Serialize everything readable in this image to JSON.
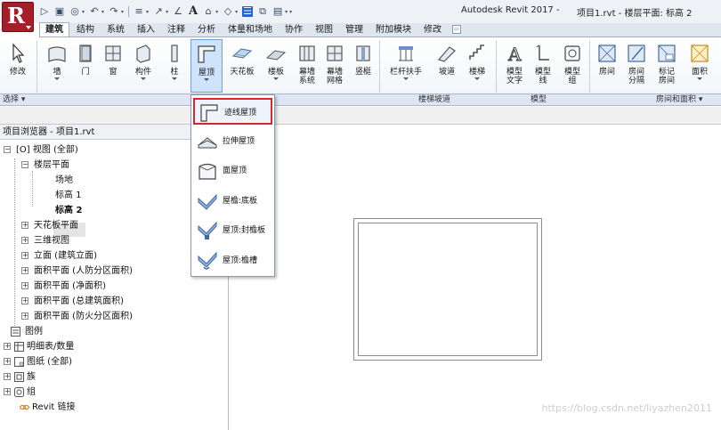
{
  "titlebar": {
    "app_title": "Autodesk Revit 2017 -",
    "doc_title": "项目1.rvt - 楼层平面: 标高 2",
    "logo_letter": "R"
  },
  "ribbon_tabs": [
    "建筑",
    "结构",
    "系统",
    "插入",
    "注释",
    "分析",
    "体量和场地",
    "协作",
    "视图",
    "管理",
    "附加模块",
    "修改"
  ],
  "active_tab": "建筑",
  "ribbon": {
    "modify": "修改",
    "wall": "墙",
    "door": "门",
    "window": "窗",
    "component": "构件",
    "column": "柱",
    "roof": "屋顶",
    "ceiling": "天花板",
    "floor": "楼板",
    "curtain_system_1": "幕墙",
    "curtain_system_2": "系统",
    "curtain_grid_1": "幕墙",
    "curtain_grid_2": "网格",
    "mullion": "竖梃",
    "railing": "栏杆扶手",
    "ramp": "坡道",
    "stair": "楼梯",
    "model_text_1": "模型",
    "model_text_2": "文字",
    "model_line_1": "模型",
    "model_line_2": "线",
    "model_group_1": "模型",
    "model_group_2": "组",
    "room": "房间",
    "room_sep_1": "房间",
    "room_sep_2": "分隔",
    "tag_room_1": "标记",
    "tag_room_2": "房间",
    "area": "面积"
  },
  "panels": {
    "select": "选择 ▾",
    "circulation": "楼梯坡道",
    "model": "模型",
    "room_area": "房间和面积 ▾"
  },
  "roof_menu": [
    {
      "label": "迹线屋顶",
      "icon": "footprint-roof-icon",
      "highlighted": true
    },
    {
      "label": "拉伸屋顶",
      "icon": "extrusion-roof-icon",
      "highlighted": false
    },
    {
      "label": "面屋顶",
      "icon": "face-roof-icon",
      "highlighted": false
    },
    {
      "label": "屋檐:底板",
      "icon": "roof-soffit-icon",
      "highlighted": false
    },
    {
      "label": "屋顶:封檐板",
      "icon": "roof-fascia-icon",
      "highlighted": false
    },
    {
      "label": "屋顶:檐槽",
      "icon": "roof-gutter-icon",
      "highlighted": false
    }
  ],
  "project_browser": {
    "title": "项目浏览器 - 项目1.rvt",
    "tree": [
      {
        "label": "[O] 视图 (全部)",
        "level": 0
      },
      {
        "label": "楼层平面",
        "level": 1
      },
      {
        "label": "场地",
        "level": 2
      },
      {
        "label": "标高 1",
        "level": 2
      },
      {
        "label": "标高 2",
        "level": 2,
        "bold": true
      },
      {
        "label": "天花板平面",
        "level": 1
      },
      {
        "label": "三维视图",
        "level": 1
      },
      {
        "label": "立面 (建筑立面)",
        "level": 1
      },
      {
        "label": "面积平面 (人防分区面积)",
        "level": 1
      },
      {
        "label": "面积平面 (净面积)",
        "level": 1
      },
      {
        "label": "面积平面 (总建筑面积)",
        "level": 1
      },
      {
        "label": "面积平面 (防火分区面积)",
        "level": 1
      },
      {
        "label": "图例",
        "level": 0
      },
      {
        "label": "明细表/数量",
        "level": 0
      },
      {
        "label": "图纸 (全部)",
        "level": 0
      },
      {
        "label": "族",
        "level": 0
      },
      {
        "label": "组",
        "level": 0
      },
      {
        "label": "Revit 链接",
        "level": 0
      }
    ]
  },
  "canvas": {
    "watermark": "https://blog.csdn.net/liyazhen2011"
  },
  "colors": {
    "accent_red": "#d9262c",
    "logo_red": "#a51e2a",
    "ribbon_blue": "#cfe3fb"
  }
}
